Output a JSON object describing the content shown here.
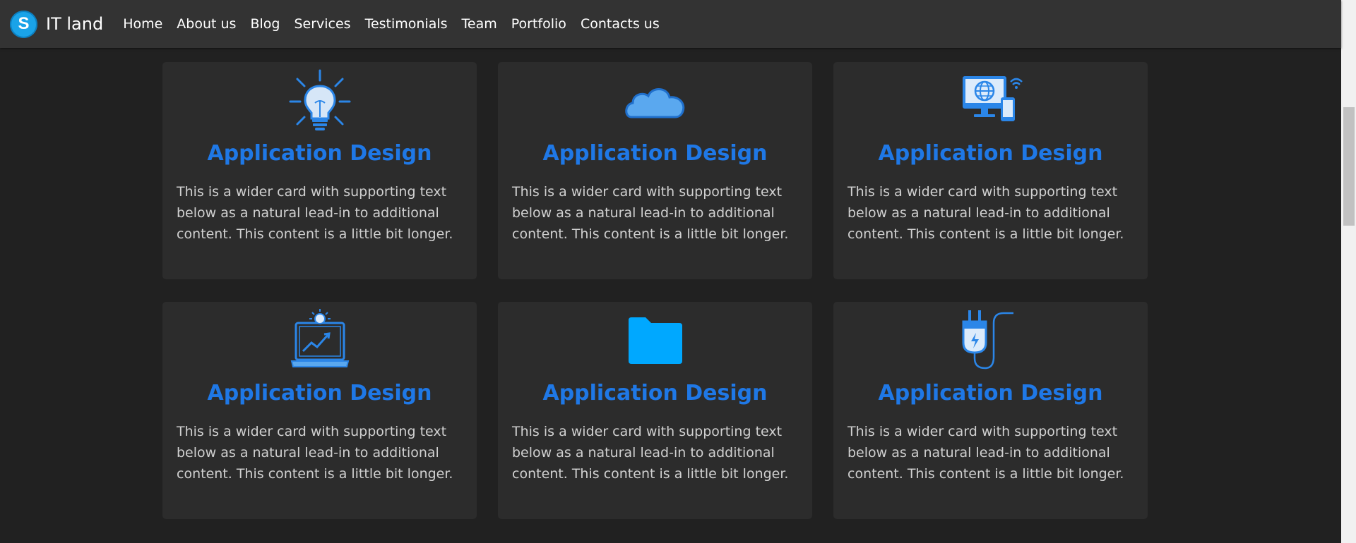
{
  "brand": {
    "logo_letter": "S",
    "name": "IT land"
  },
  "nav": {
    "links": [
      "Home",
      "About us",
      "Blog",
      "Services",
      "Testimonials",
      "Team",
      "Portfolio",
      "Contacts us"
    ]
  },
  "colors": {
    "accent": "#1f78e6",
    "navbar_bg": "#333333",
    "page_bg": "#212121",
    "card_bg": "#2c2c2c"
  },
  "cards": [
    {
      "icon": "lightbulb-icon",
      "title": "Application Design",
      "text": "This is a wider card with supporting text below as a natural lead-in to additional content. This content is a little bit longer."
    },
    {
      "icon": "cloud-icon",
      "title": "Application Design",
      "text": "This is a wider card with supporting text below as a natural lead-in to additional content. This content is a little bit longer."
    },
    {
      "icon": "devices-icon",
      "title": "Application Design",
      "text": "This is a wider card with supporting text below as a natural lead-in to additional content. This content is a little bit longer."
    },
    {
      "icon": "laptop-growth-icon",
      "title": "Application Design",
      "text": "This is a wider card with supporting text below as a natural lead-in to additional content. This content is a little bit longer."
    },
    {
      "icon": "folder-icon",
      "title": "Application Design",
      "text": "This is a wider card with supporting text below as a natural lead-in to additional content. This content is a little bit longer."
    },
    {
      "icon": "plug-icon",
      "title": "Application Design",
      "text": "This is a wider card with supporting text below as a natural lead-in to additional content. This content is a little bit longer."
    }
  ]
}
